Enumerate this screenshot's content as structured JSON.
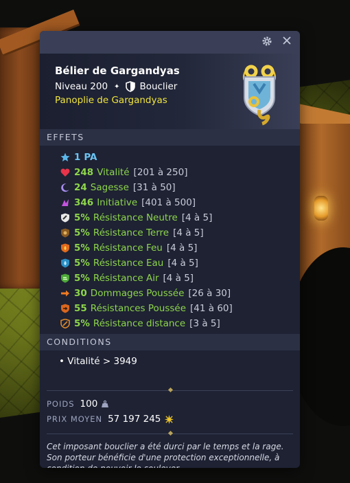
{
  "item": {
    "name": "Bélier de Gargandyas",
    "level": "Niveau 200",
    "separator": "✦",
    "type": "Bouclier",
    "set": "Panoplie de Gargandyas"
  },
  "topbar": {
    "settings_icon": "gear-icon",
    "close_icon": "close-icon"
  },
  "effects_header": "EFFETS",
  "effects": [
    {
      "icon": "star-icon",
      "value": "1",
      "name": "PA",
      "range": "",
      "color": "#6cc4f2"
    },
    {
      "icon": "heart-icon",
      "value": "248",
      "name": "Vitalité",
      "range": "[201 à 250]"
    },
    {
      "icon": "moon-icon",
      "value": "24",
      "name": "Sagesse",
      "range": "[31 à 50]"
    },
    {
      "icon": "initiative-icon",
      "value": "346",
      "name": "Initiative",
      "range": "[401 à 500]"
    },
    {
      "icon": "neutral-resistance-icon",
      "value": "5%",
      "name": "Résistance Neutre",
      "range": "[4 à 5]"
    },
    {
      "icon": "earth-resistance-icon",
      "value": "5%",
      "name": "Résistance Terre",
      "range": "[4 à 5]"
    },
    {
      "icon": "fire-resistance-icon",
      "value": "5%",
      "name": "Résistance Feu",
      "range": "[4 à 5]"
    },
    {
      "icon": "water-resistance-icon",
      "value": "5%",
      "name": "Résistance Eau",
      "range": "[4 à 5]"
    },
    {
      "icon": "air-resistance-icon",
      "value": "5%",
      "name": "Résistance Air",
      "range": "[4 à 5]"
    },
    {
      "icon": "push-damage-icon",
      "value": "30",
      "name": "Dommages Poussée",
      "range": "[26 à 30]"
    },
    {
      "icon": "push-resistance-icon",
      "value": "55",
      "name": "Résistances Poussée",
      "range": "[41 à 60]"
    },
    {
      "icon": "distance-resistance-icon",
      "value": "5%",
      "name": "Résistance distance",
      "range": "[3 à 5]"
    }
  ],
  "conditions_header": "CONDITIONS",
  "conditions": [
    "• Vitalité > 3949"
  ],
  "stats": {
    "weight_label": "POIDS",
    "weight_value": "100",
    "price_label": "PRIX MOYEN",
    "price_value": "57 197 245"
  },
  "description": "Cet imposant bouclier a été durci par le temps et la rage. Son porteur bénéficie d'une protection exceptionnelle, à condition de pouvoir le soulever.",
  "colors": {
    "panel_bg": "#1e2233",
    "effect_green": "#8ed64a",
    "set_yellow": "#f1e53c",
    "pa_blue": "#6cc4f2"
  }
}
